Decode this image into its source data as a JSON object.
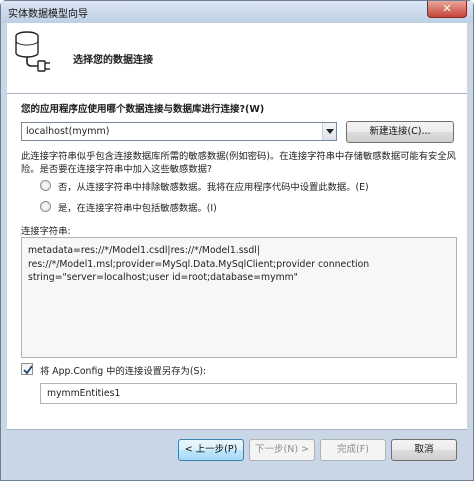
{
  "window": {
    "title": "实体数据模型向导",
    "close_glyph": "✕"
  },
  "header": {
    "title": "选择您的数据连接"
  },
  "connection": {
    "question": "您的应用程序应使用哪个数据连接与数据库进行连接?(W)",
    "selected": "localhost(mymm)",
    "new_connection_label": "新建连接(C)..."
  },
  "sensitive": {
    "description": "此连接字符串似乎包含连接数据库所需的敏感数据(例如密码)。在连接字符串中存储敏感数据可能有安全风险。是否要在连接字符串中加入这些敏感数据?",
    "option_exclude": "否，从连接字符串中排除敏感数据。我将在应用程序代码中设置此数据。(E)",
    "option_include": "是，在连接字符串中包括敏感数据。(I)"
  },
  "connection_string": {
    "label": "连接字符串:",
    "lines": [
      "metadata=res://*/Model1.csdl|res://*/Model1.ssdl|",
      "res://*/Model1.msl;provider=MySql.Data.MySqlClient;provider connection",
      "string=\"server=localhost;user id=root;database=mymm\""
    ]
  },
  "save_setting": {
    "label": "将 App.Config 中的连接设置另存为(S):",
    "checked": true,
    "value": "mymmEntities1"
  },
  "buttons": {
    "back": "< 上一步(P)",
    "next": "下一步(N) >",
    "finish": "完成(F)",
    "cancel": "取消"
  },
  "colors": {
    "frame": "#c8d6e6",
    "close": "#c7443a",
    "focus_border": "#3c7fb1"
  },
  "icons": {
    "header": "database-plug-icon",
    "dropdown": "chevron-down-icon",
    "checkbox": "checkmark-icon"
  }
}
